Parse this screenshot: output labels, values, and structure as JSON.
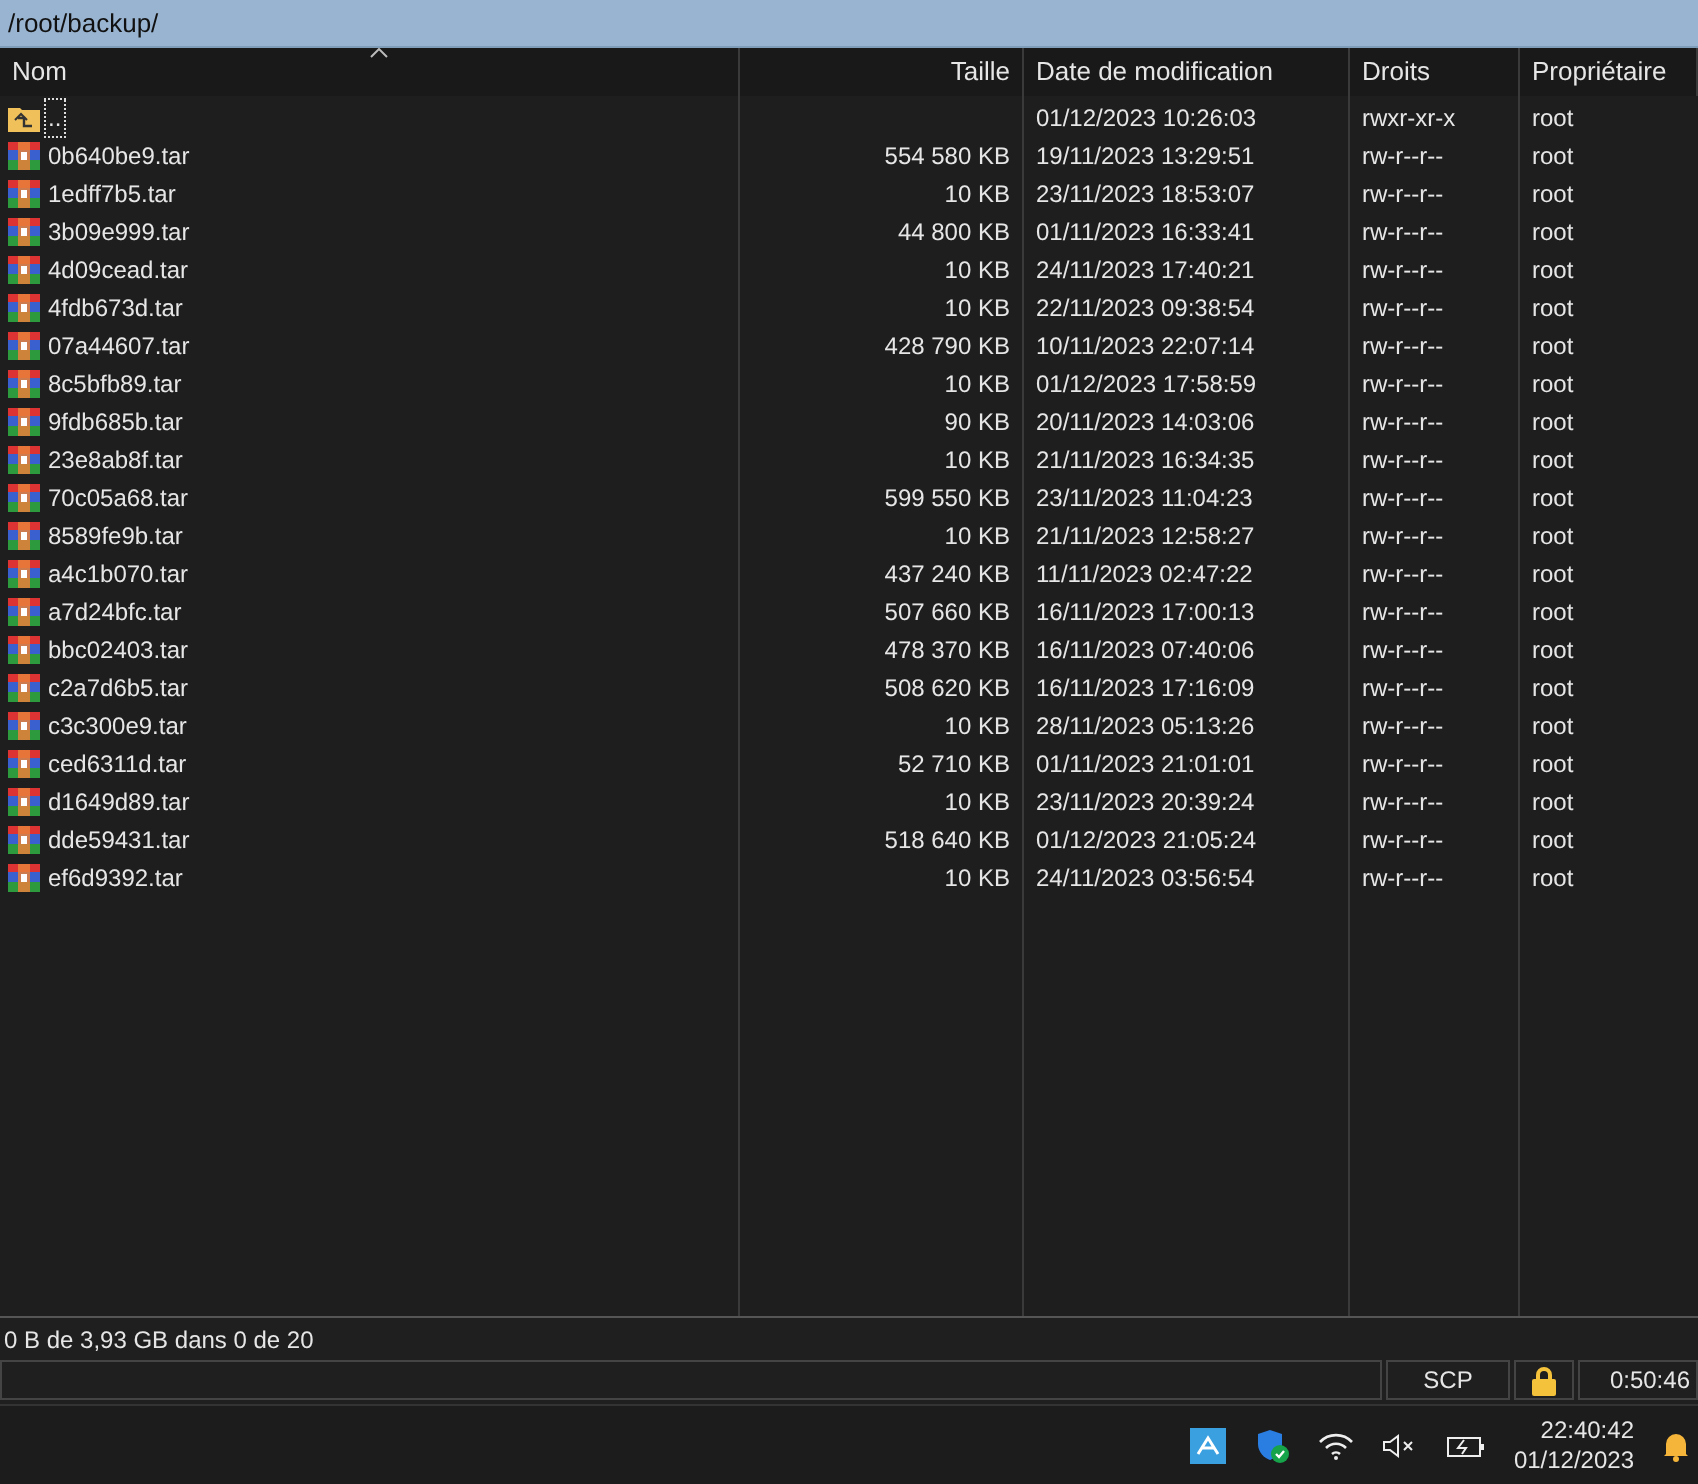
{
  "path_bar": {
    "text": "/root/backup/"
  },
  "columns": [
    {
      "label": "Nom",
      "sorted": true
    },
    {
      "label": "Taille",
      "sorted": false
    },
    {
      "label": "Date de modification",
      "sorted": false
    },
    {
      "label": "Droits",
      "sorted": false
    },
    {
      "label": "Propriétaire",
      "sorted": false
    }
  ],
  "rows": [
    {
      "kind": "parent",
      "name": "..",
      "size": "",
      "date": "01/12/2023 10:26:03",
      "rights": "rwxr-xr-x",
      "owner": "root",
      "focused": true
    },
    {
      "kind": "archive",
      "name": "0b640be9.tar",
      "size": "554 580 KB",
      "date": "19/11/2023 13:29:51",
      "rights": "rw-r--r--",
      "owner": "root",
      "focused": false
    },
    {
      "kind": "archive",
      "name": "1edff7b5.tar",
      "size": "10 KB",
      "date": "23/11/2023 18:53:07",
      "rights": "rw-r--r--",
      "owner": "root",
      "focused": false
    },
    {
      "kind": "archive",
      "name": "3b09e999.tar",
      "size": "44 800 KB",
      "date": "01/11/2023 16:33:41",
      "rights": "rw-r--r--",
      "owner": "root",
      "focused": false
    },
    {
      "kind": "archive",
      "name": "4d09cead.tar",
      "size": "10 KB",
      "date": "24/11/2023 17:40:21",
      "rights": "rw-r--r--",
      "owner": "root",
      "focused": false
    },
    {
      "kind": "archive",
      "name": "4fdb673d.tar",
      "size": "10 KB",
      "date": "22/11/2023 09:38:54",
      "rights": "rw-r--r--",
      "owner": "root",
      "focused": false
    },
    {
      "kind": "archive",
      "name": "07a44607.tar",
      "size": "428 790 KB",
      "date": "10/11/2023 22:07:14",
      "rights": "rw-r--r--",
      "owner": "root",
      "focused": false
    },
    {
      "kind": "archive",
      "name": "8c5bfb89.tar",
      "size": "10 KB",
      "date": "01/12/2023 17:58:59",
      "rights": "rw-r--r--",
      "owner": "root",
      "focused": false
    },
    {
      "kind": "archive",
      "name": "9fdb685b.tar",
      "size": "90 KB",
      "date": "20/11/2023 14:03:06",
      "rights": "rw-r--r--",
      "owner": "root",
      "focused": false
    },
    {
      "kind": "archive",
      "name": "23e8ab8f.tar",
      "size": "10 KB",
      "date": "21/11/2023 16:34:35",
      "rights": "rw-r--r--",
      "owner": "root",
      "focused": false
    },
    {
      "kind": "archive",
      "name": "70c05a68.tar",
      "size": "599 550 KB",
      "date": "23/11/2023 11:04:23",
      "rights": "rw-r--r--",
      "owner": "root",
      "focused": false
    },
    {
      "kind": "archive",
      "name": "8589fe9b.tar",
      "size": "10 KB",
      "date": "21/11/2023 12:58:27",
      "rights": "rw-r--r--",
      "owner": "root",
      "focused": false
    },
    {
      "kind": "archive",
      "name": "a4c1b070.tar",
      "size": "437 240 KB",
      "date": "11/11/2023 02:47:22",
      "rights": "rw-r--r--",
      "owner": "root",
      "focused": false
    },
    {
      "kind": "archive",
      "name": "a7d24bfc.tar",
      "size": "507 660 KB",
      "date": "16/11/2023 17:00:13",
      "rights": "rw-r--r--",
      "owner": "root",
      "focused": false
    },
    {
      "kind": "archive",
      "name": "bbc02403.tar",
      "size": "478 370 KB",
      "date": "16/11/2023 07:40:06",
      "rights": "rw-r--r--",
      "owner": "root",
      "focused": false
    },
    {
      "kind": "archive",
      "name": "c2a7d6b5.tar",
      "size": "508 620 KB",
      "date": "16/11/2023 17:16:09",
      "rights": "rw-r--r--",
      "owner": "root",
      "focused": false
    },
    {
      "kind": "archive",
      "name": "c3c300e9.tar",
      "size": "10 KB",
      "date": "28/11/2023 05:13:26",
      "rights": "rw-r--r--",
      "owner": "root",
      "focused": false
    },
    {
      "kind": "archive",
      "name": "ced6311d.tar",
      "size": "52 710 KB",
      "date": "01/11/2023 21:01:01",
      "rights": "rw-r--r--",
      "owner": "root",
      "focused": false
    },
    {
      "kind": "archive",
      "name": "d1649d89.tar",
      "size": "10 KB",
      "date": "23/11/2023 20:39:24",
      "rights": "rw-r--r--",
      "owner": "root",
      "focused": false
    },
    {
      "kind": "archive",
      "name": "dde59431.tar",
      "size": "518 640 KB",
      "date": "01/12/2023 21:05:24",
      "rights": "rw-r--r--",
      "owner": "root",
      "focused": false
    },
    {
      "kind": "archive",
      "name": "ef6d9392.tar",
      "size": "10 KB",
      "date": "24/11/2023 03:56:54",
      "rights": "rw-r--r--",
      "owner": "root",
      "focused": false
    }
  ],
  "status": {
    "selection": "0 B de 3,93 GB dans 0 de 20",
    "protocol": "SCP",
    "session_time": "0:50:46"
  },
  "taskbar": {
    "time": "22:40:42",
    "date": "01/12/2023"
  }
}
